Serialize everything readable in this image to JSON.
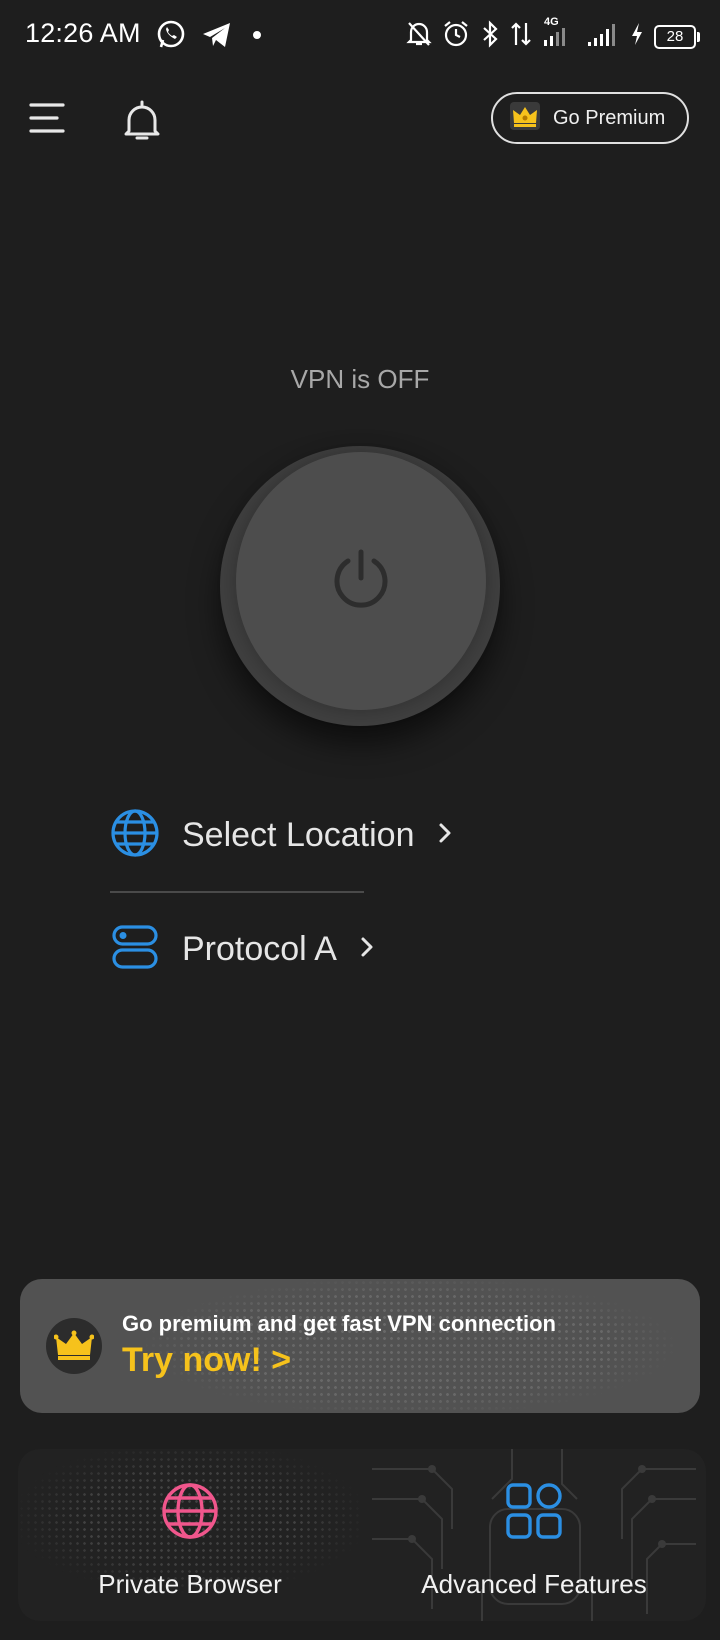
{
  "status_bar": {
    "time": "12:26 AM",
    "network_label": "4G",
    "battery": "28",
    "icons": [
      "whatsapp-icon",
      "telegram-icon",
      "dot-icon",
      "bell-off-icon",
      "alarm-icon",
      "bluetooth-icon",
      "data-arrows-icon",
      "signal-icon",
      "signal-icon",
      "charging-icon",
      "battery-icon"
    ]
  },
  "header": {
    "premium_label": "Go Premium"
  },
  "vpn": {
    "status_text": "VPN is OFF"
  },
  "options": {
    "location_label": "Select Location",
    "protocol_label": "Protocol A"
  },
  "promo": {
    "text": "Go premium and get fast VPN connection",
    "cta": "Try now! >"
  },
  "bottom": {
    "browser_label": "Private Browser",
    "features_label": "Advanced Features"
  },
  "colors": {
    "background": "#1e1e1e",
    "accent_blue": "#2b8fe3",
    "accent_pink": "#f0568c",
    "accent_gold": "#f6c21c"
  }
}
